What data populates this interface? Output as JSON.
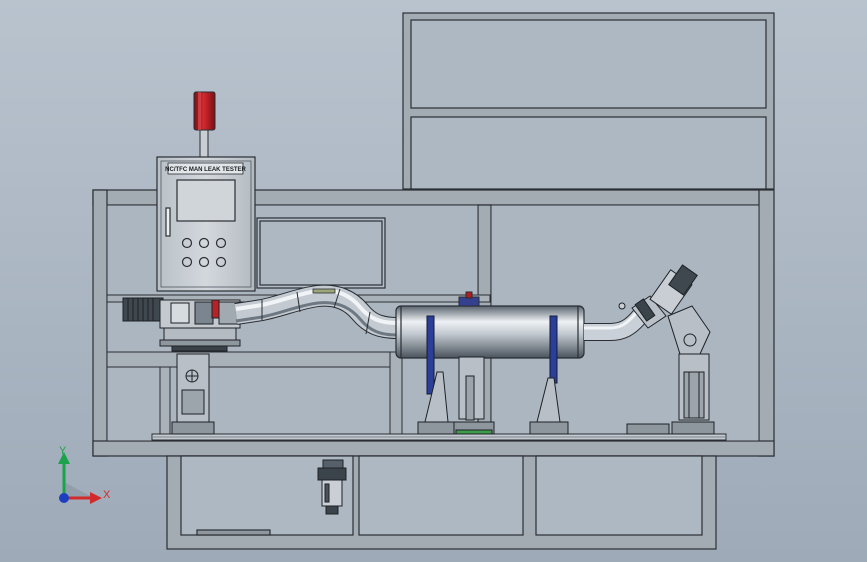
{
  "colors": {
    "background_top": "#b7c1cc",
    "background_bottom": "#9fabb9",
    "frame": "#9ea6ad",
    "panel": "#c5cbd1",
    "stroke": "#2a2e33",
    "pipe_light": "#eef2f5",
    "pipe_dark": "#6f7a84",
    "clamp_blue": "#2b3f99",
    "beacon_red": "#b01c22",
    "axis_y": "#1aa34a",
    "axis_x": "#d22a2a",
    "axis_z": "#1d3fbf"
  },
  "control_box": {
    "nameplate": "NC/TFC MAN LEAK TESTER"
  },
  "triad": {
    "y_label": "Y",
    "x_label": "X",
    "icons": [
      "coordinate-triad-icon"
    ]
  }
}
